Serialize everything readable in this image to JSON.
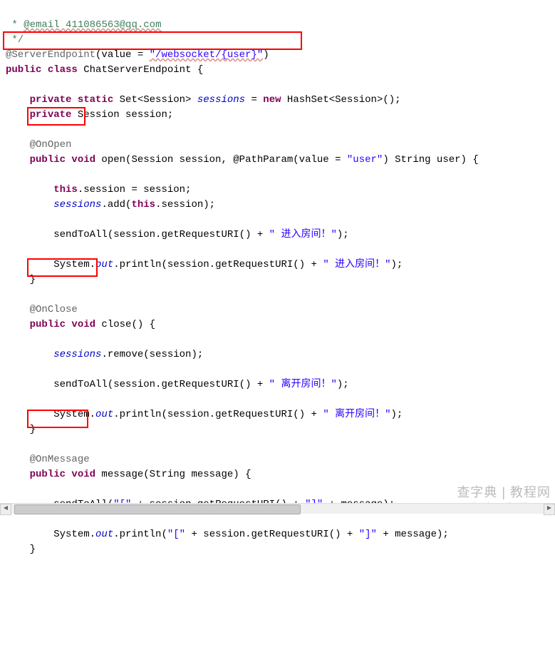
{
  "doc": {
    "comment_email_prefix": " * ",
    "email_tag": "@email",
    "email_value": " 411086563@qq.com",
    "comment_close": " */",
    "anno_server": "@ServerEndpoint",
    "serverendpoint_args": "(value = ",
    "serverendpoint_str": "\"/websocket/{user}\"",
    "serverendpoint_close": ")",
    "class_decl_kw1": "public",
    "class_decl_kw2": "class",
    "class_name": " ChatServerEndpoint {",
    "field1_kw": "private static",
    "field1_type": " Set<Session> ",
    "field1_name": "sessions",
    "field1_eq": " = ",
    "field1_new": "new",
    "field1_rest": " HashSet<Session>();",
    "field2_kw": "private",
    "field2_rest": " Session session;",
    "anno_open": "@OnOpen",
    "open_kw": "public void",
    "open_sig": " open(Session session, @PathParam(value = ",
    "open_param_str": "\"user\"",
    "open_sig2": ") String user) {",
    "open_l1a": "this",
    "open_l1b": ".session = session;",
    "open_l2a": "sessions",
    "open_l2b": ".add(",
    "open_l2c": "this",
    "open_l2d": ".session);",
    "open_l3": "sendToAll(session.getRequestURI() + ",
    "open_l3_str": "\" 进入房间！\"",
    "open_l3_end": ");",
    "open_l4a": "System.",
    "open_l4_out": "out",
    "open_l4b": ".println(session.getRequestURI() + ",
    "open_l4_str": "\" 进入房间！\"",
    "open_l4_end": ");",
    "close_brace": "}",
    "anno_close": "@OnClose",
    "close_kw": "public void",
    "close_sig": " close() {",
    "close_l1a": "sessions",
    "close_l1b": ".remove(session);",
    "close_l2": "sendToAll(session.getRequestURI() + ",
    "close_l2_str": "\" 离开房间！\"",
    "close_l2_end": ");",
    "close_l3a": "System.",
    "close_l3_out": "out",
    "close_l3b": ".println(session.getRequestURI() + ",
    "close_l3_str": "\" 离开房间！\"",
    "close_l3_end": ");",
    "anno_msg": "@OnMessage",
    "msg_kw": "public void",
    "msg_sig": " message(String message) {",
    "msg_l1": "sendToAll(",
    "msg_l1_s1": "\"[\"",
    "msg_l1_mid": " + session.getRequestURI() + ",
    "msg_l1_s2": "\"]\"",
    "msg_l1_end": " + message);",
    "msg_l2a": "System.",
    "msg_l2_out": "out",
    "msg_l2b": ".println(",
    "msg_l2_s1": "\"[\"",
    "msg_l2_mid": " + session.getRequestURI() + ",
    "msg_l2_s2": "\"]\"",
    "msg_l2_end": " + message);",
    "indent1": "    ",
    "indent2": "        ",
    "watermark": "查字典 | 教程网",
    "watermark2": "jiaocheng.chazidian.com"
  }
}
